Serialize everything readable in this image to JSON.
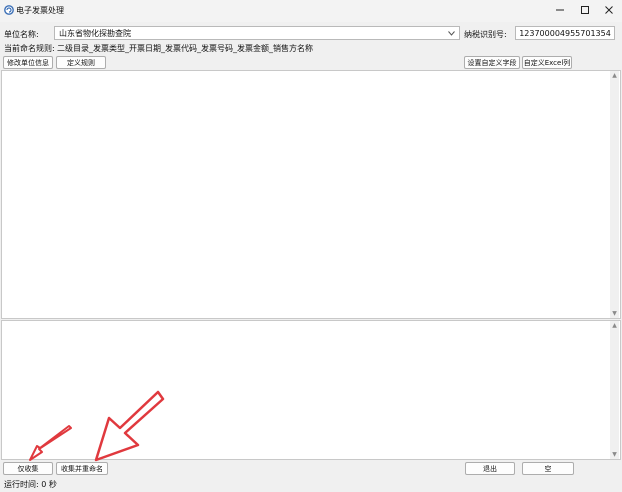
{
  "window": {
    "title": "电子发票处理"
  },
  "header": {
    "unit_name_label": "单位名称:",
    "unit_name_value": "山东省物化探勘查院",
    "tax_id_label": "纳税识别号:",
    "tax_id_value": "123700004955701354",
    "naming_rule_label": "当前命名规则:",
    "naming_rule_value": "二级目录_发票类型_开票日期_发票代码_发票号码_发票金额_销售方名称"
  },
  "toolbar": {
    "edit_unit_info": "修改单位信息",
    "define_rule": "定义规则",
    "set_custom_fields": "设置自定义字段",
    "custom_excel_columns": "自定义Excel列"
  },
  "footer": {
    "collect_only": "仅收集",
    "collect_and_rename": "收集并重命名",
    "exit": "退出",
    "blank_button": "空",
    "runtime": "运行时间: 0 秒"
  },
  "colors": {
    "annotation_arrow": "#e0393e"
  },
  "icons": [
    "app-icon",
    "minimize-icon",
    "maximize-icon",
    "close-icon",
    "dropdown-chevron-icon",
    "scroll-up-icon",
    "scroll-down-icon",
    "arrow-annotation"
  ]
}
